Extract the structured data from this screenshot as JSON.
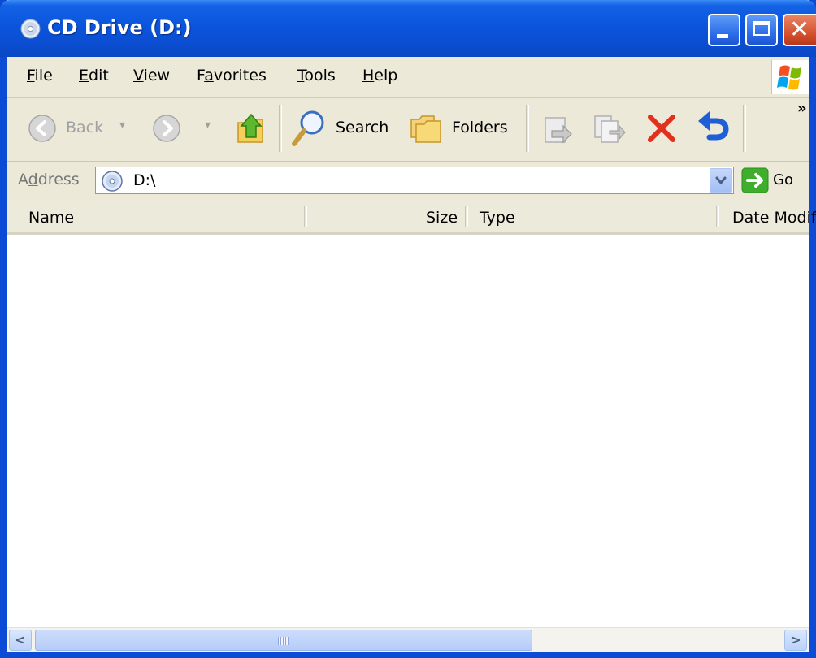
{
  "window": {
    "title": "CD Drive (D:)",
    "buttons": {
      "minimize": "minimize",
      "maximize": "maximize",
      "close": "close"
    }
  },
  "menu": [
    {
      "label": "File",
      "key": "F",
      "rest": "ile"
    },
    {
      "label": "Edit",
      "key": "E",
      "rest": "dit"
    },
    {
      "label": "View",
      "key": "V",
      "rest": "iew"
    },
    {
      "label": "Favorites",
      "pre": "F",
      "key": "a",
      "rest": "vorites"
    },
    {
      "label": "Tools",
      "key": "T",
      "rest": "ools"
    },
    {
      "label": "Help",
      "key": "H",
      "rest": "elp"
    }
  ],
  "toolbar": {
    "back_label": "Back",
    "search_label": "Search",
    "folders_label": "Folders",
    "overflow": "»"
  },
  "address": {
    "label": "Address",
    "label_key": "d",
    "label_pre": "A",
    "label_rest": "dress",
    "value": "D:\\",
    "go_label": "Go"
  },
  "list": {
    "columns": [
      "Name",
      "Size",
      "Type",
      "Date Modif"
    ],
    "rows": []
  },
  "colors": {
    "titlebar": "#0a55dc",
    "chrome": "#ece9d8",
    "close_button": "#d65430"
  }
}
